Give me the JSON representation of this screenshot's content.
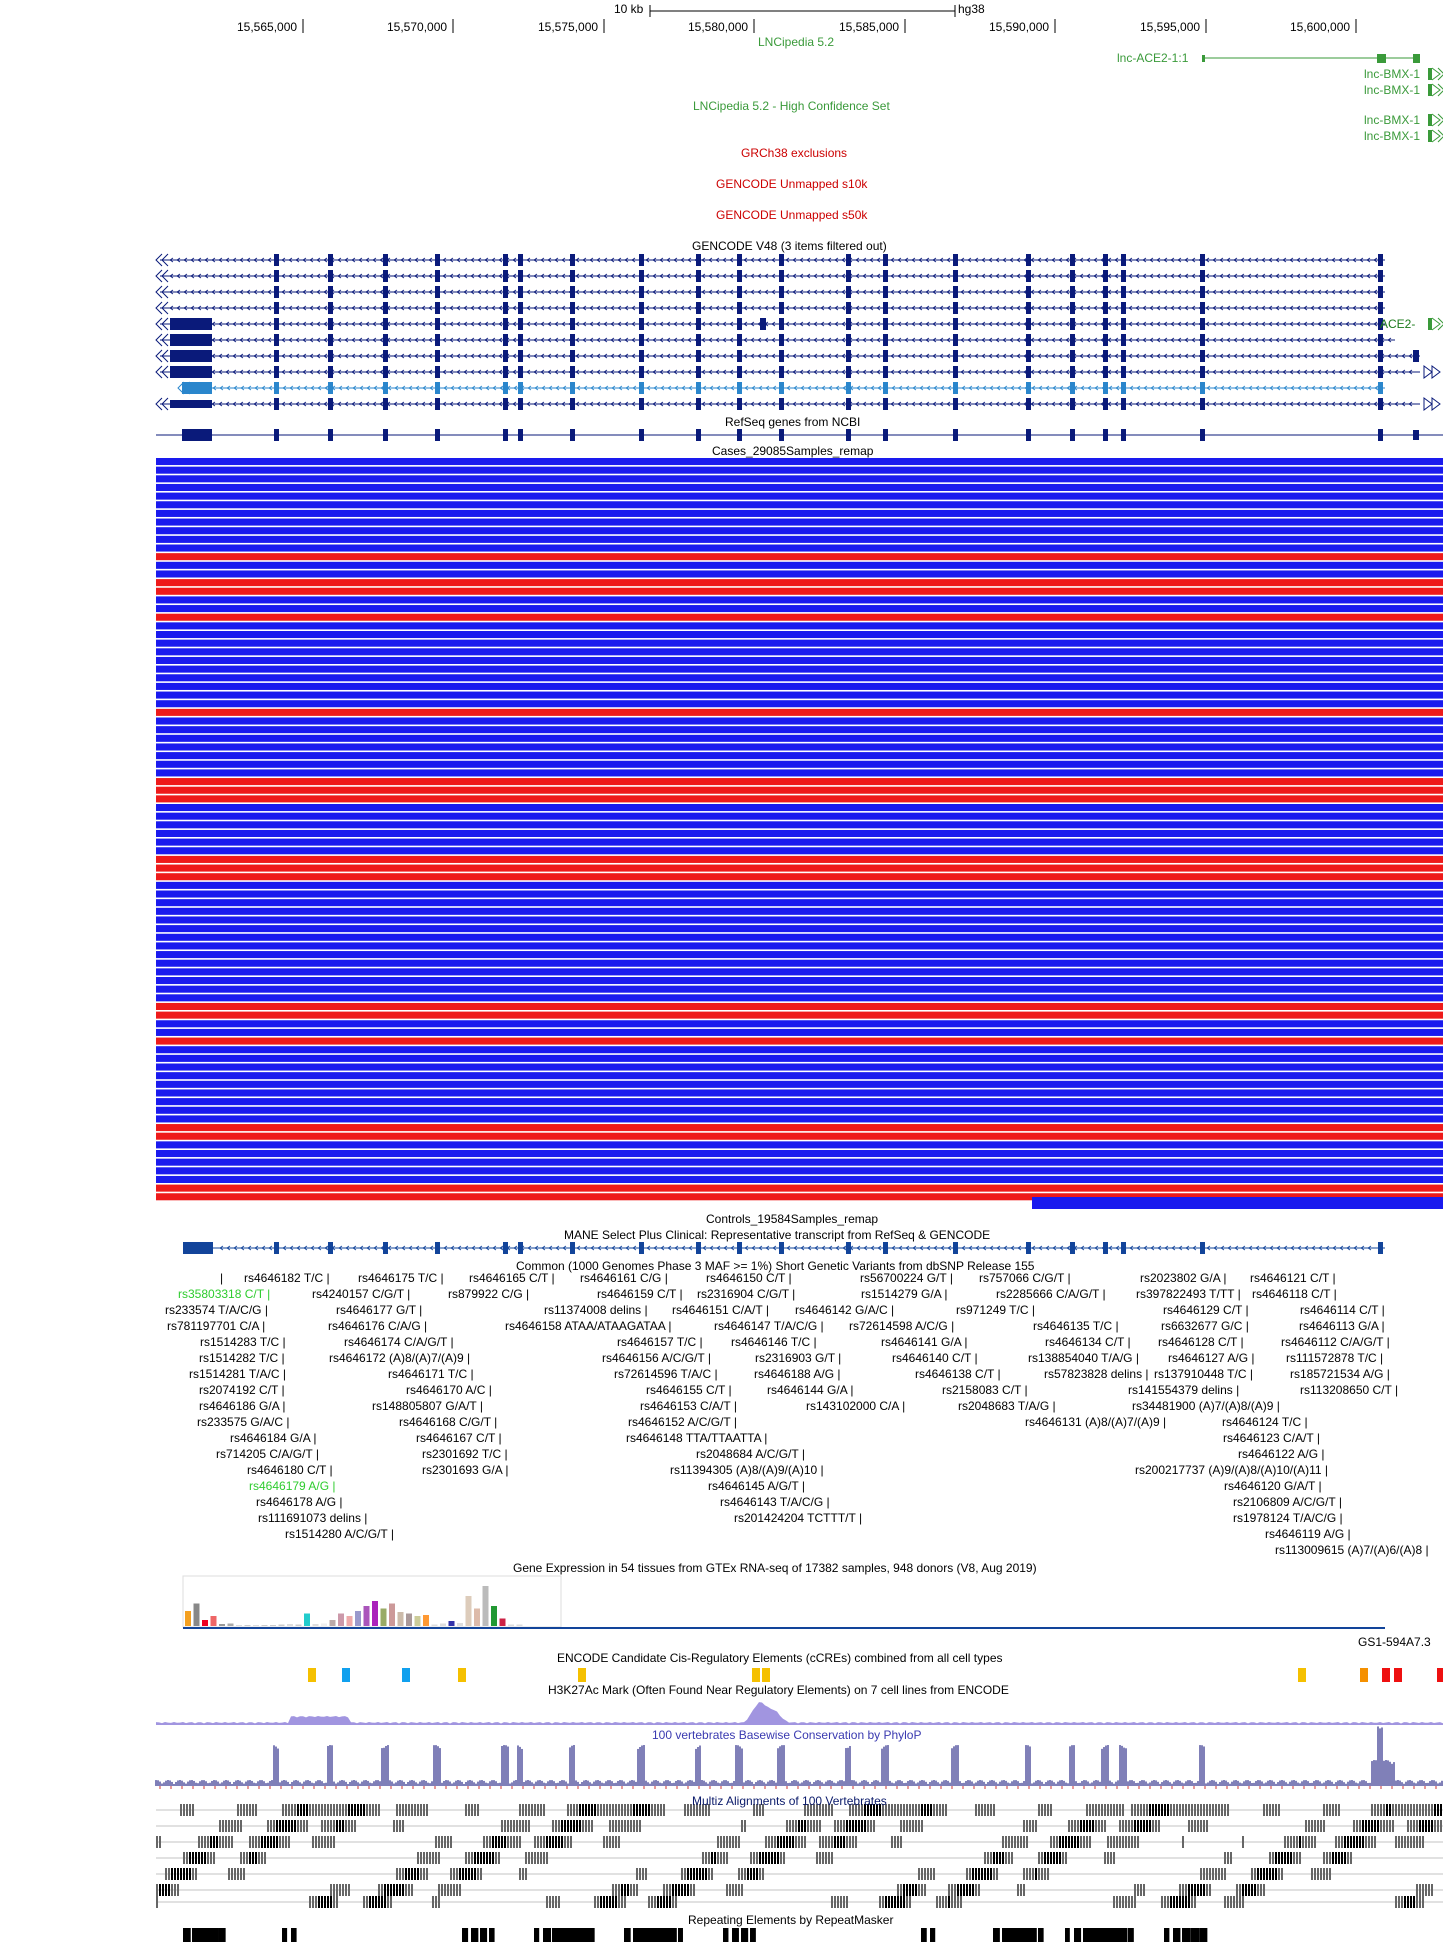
{
  "ruler": {
    "scale_label": "10 kb",
    "assembly": "hg38",
    "positions": [
      "15,565,000",
      "15,570,000",
      "15,575,000",
      "15,580,000",
      "15,585,000",
      "15,590,000",
      "15,595,000",
      "15,600,000"
    ]
  },
  "tracks": {
    "lncipedia": "LNCipedia 5.2",
    "lncipedia_hc": "LNCipedia 5.2 - High Confidence Set",
    "grch38_exclusions": "GRCh38 exclusions",
    "gencode_unmapped_10k": "GENCODE Unmapped s10k",
    "gencode_unmapped_50k": "GENCODE Unmapped s50k",
    "gencode_v48": "GENCODE V48 (3 items filtered out)",
    "refseq": "RefSeq genes from NCBI",
    "cases": "Cases_29085Samples_remap",
    "controls": "Controls_19584Samples_remap",
    "mane": "MANE Select Plus Clinical: Representative transcript from RefSeq & GENCODE",
    "dbsnp": "Common (1000 Genomes Phase 3 MAF >= 1%) Short Genetic Variants from dbSNP Release 155",
    "gtex": "Gene Expression in 54 tissues from GTEx RNA-seq of 17382 samples, 948 donors (V8, Aug 2019)",
    "gtex_gene": "GS1-594A7.3",
    "ccre": "ENCODE Candidate Cis-Regulatory Elements (cCREs) combined from all cell types",
    "h3k27ac": "H3K27Ac Mark (Often Found Near Regulatory Elements) on 7 cell lines from ENCODE",
    "phylop": "100 vertebrates Basewise Conservation by PhyloP",
    "multiz": "Multiz Alignments of 100 Vertebrates",
    "repeatmasker": "Repeating Elements by RepeatMasker"
  },
  "lnc_items": {
    "ace2": "lnc-ACE2-1:1",
    "bmx1": "lnc-BMX-1",
    "bmx2": "lnc-BMX-1",
    "bmx3": "lnc-BMX-1",
    "bmx4": "lnc-BMX-1",
    "ace2_gene": "ACE2-"
  },
  "snps": [
    {
      "t": "rs4646182 T/C",
      "c": "#000"
    },
    {
      "t": "rs4646175 T/C",
      "c": "#000"
    },
    {
      "t": "rs4646165 C/T",
      "c": "#000"
    },
    {
      "t": "rs4646161 C/G",
      "c": "#000"
    },
    {
      "t": "rs4646150 C/T",
      "c": "#000"
    },
    {
      "t": "rs56700224 G/T",
      "c": "#000"
    },
    {
      "t": "rs757066 C/G/T",
      "c": "#000"
    },
    {
      "t": "rs2023802 G/A",
      "c": "#000"
    },
    {
      "t": "rs4646121 C/T",
      "c": "#000"
    },
    {
      "t": "rs35803318 C/T",
      "c": "#2ecc2e"
    },
    {
      "t": "rs4240157 C/G/T",
      "c": "#000"
    },
    {
      "t": "rs879922 C/G",
      "c": "#000"
    },
    {
      "t": "rs4646159 C/T",
      "c": "#000"
    },
    {
      "t": "rs2316904 C/G/T",
      "c": "#000"
    },
    {
      "t": "rs1514279 G/A",
      "c": "#000"
    },
    {
      "t": "rs2285666 C/A/G/T",
      "c": "#000"
    },
    {
      "t": "rs397822493 T/TT",
      "c": "#000"
    },
    {
      "t": "rs4646118 C/T",
      "c": "#000"
    },
    {
      "t": "rs233574 T/A/C/G",
      "c": "#000"
    },
    {
      "t": "rs4646177 G/T",
      "c": "#000"
    },
    {
      "t": "rs11374008 delins",
      "c": "#000"
    },
    {
      "t": "rs4646151 C/A/T",
      "c": "#000"
    },
    {
      "t": "rs4646142 G/A/C",
      "c": "#000"
    },
    {
      "t": "rs971249 T/C",
      "c": "#000"
    },
    {
      "t": "rs4646129 C/T",
      "c": "#000"
    },
    {
      "t": "rs4646114 C/T",
      "c": "#000"
    },
    {
      "t": "rs781197701 C/A",
      "c": "#000"
    },
    {
      "t": "rs4646176 C/A/G",
      "c": "#000"
    },
    {
      "t": "rs4646158 ATAA/ATAAGATAA",
      "c": "#000"
    },
    {
      "t": "rs4646147 T/A/C/G",
      "c": "#000"
    },
    {
      "t": "rs72614598 A/C/G",
      "c": "#000"
    },
    {
      "t": "rs4646135 T/C",
      "c": "#000"
    },
    {
      "t": "rs6632677 G/C",
      "c": "#000"
    },
    {
      "t": "rs4646113 G/A",
      "c": "#000"
    },
    {
      "t": "rs1514283 T/C",
      "c": "#000"
    },
    {
      "t": "rs4646174 C/A/G/T",
      "c": "#000"
    },
    {
      "t": "rs4646157 T/C",
      "c": "#000"
    },
    {
      "t": "rs4646146 T/C",
      "c": "#000"
    },
    {
      "t": "rs4646141 G/A",
      "c": "#000"
    },
    {
      "t": "rs4646134 C/T",
      "c": "#000"
    },
    {
      "t": "rs4646128 C/T",
      "c": "#000"
    },
    {
      "t": "rs4646112 C/A/G/T",
      "c": "#000"
    },
    {
      "t": "rs1514282 T/C",
      "c": "#000"
    },
    {
      "t": "rs4646172 (A)8/(A)7/(A)9",
      "c": "#000"
    },
    {
      "t": "rs4646156 A/C/G/T",
      "c": "#000"
    },
    {
      "t": "rs2316903 G/T",
      "c": "#000"
    },
    {
      "t": "rs4646140 C/T",
      "c": "#000"
    },
    {
      "t": "rs138854040 T/A/G",
      "c": "#000"
    },
    {
      "t": "rs4646127 A/G",
      "c": "#000"
    },
    {
      "t": "rs111572878 T/C",
      "c": "#000"
    },
    {
      "t": "rs1514281 T/A/C",
      "c": "#000"
    },
    {
      "t": "rs4646171 T/C",
      "c": "#000"
    },
    {
      "t": "rs72614596 T/A/C",
      "c": "#000"
    },
    {
      "t": "rs4646188 A/G",
      "c": "#000"
    },
    {
      "t": "rs4646138 C/T",
      "c": "#000"
    },
    {
      "t": "rs57823828 delins",
      "c": "#000"
    },
    {
      "t": "rs137910448 T/C",
      "c": "#000"
    },
    {
      "t": "rs185721534 A/G",
      "c": "#000"
    },
    {
      "t": "rs2074192 C/T",
      "c": "#000"
    },
    {
      "t": "rs4646170 A/C",
      "c": "#000"
    },
    {
      "t": "rs4646155 C/T",
      "c": "#000"
    },
    {
      "t": "rs4646144 G/A",
      "c": "#000"
    },
    {
      "t": "rs2158083 C/T",
      "c": "#000"
    },
    {
      "t": "rs141554379 delins",
      "c": "#000"
    },
    {
      "t": "rs113208650 C/T",
      "c": "#000"
    },
    {
      "t": "rs4646186 G/A",
      "c": "#000"
    },
    {
      "t": "rs148805807 G/A/T",
      "c": "#000"
    },
    {
      "t": "rs4646153 C/A/T",
      "c": "#000"
    },
    {
      "t": "rs143102000 C/A",
      "c": "#000"
    },
    {
      "t": "rs2048683 T/A/G",
      "c": "#000"
    },
    {
      "t": "rs34481900 (A)7/(A)8/(A)9",
      "c": "#000"
    },
    {
      "t": "rs233575 G/A/C",
      "c": "#000"
    },
    {
      "t": "rs4646168 C/G/T",
      "c": "#000"
    },
    {
      "t": "rs4646152 A/C/G/T",
      "c": "#000"
    },
    {
      "t": "rs4646131 (A)8/(A)7/(A)9",
      "c": "#000"
    },
    {
      "t": "rs4646124 T/C",
      "c": "#000"
    },
    {
      "t": "rs4646184 G/A",
      "c": "#000"
    },
    {
      "t": "rs4646167 C/T",
      "c": "#000"
    },
    {
      "t": "rs4646148 TTA/TTAATTA",
      "c": "#000"
    },
    {
      "t": "rs4646123 C/A/T",
      "c": "#000"
    },
    {
      "t": "rs714205 C/A/G/T",
      "c": "#000"
    },
    {
      "t": "rs2301692 T/C",
      "c": "#000"
    },
    {
      "t": "rs2048684 A/C/G/T",
      "c": "#000"
    },
    {
      "t": "rs4646122 A/G",
      "c": "#000"
    },
    {
      "t": "rs4646180 C/T",
      "c": "#000"
    },
    {
      "t": "rs2301693 G/A",
      "c": "#000"
    },
    {
      "t": "rs11394305 (A)8/(A)9/(A)10",
      "c": "#000"
    },
    {
      "t": "rs200217737 (A)9/(A)8/(A)10/(A)11",
      "c": "#000"
    },
    {
      "t": "rs4646179 A/G",
      "c": "#2ecc2e"
    },
    {
      "t": "rs4646145 A/G/T",
      "c": "#000"
    },
    {
      "t": "rs4646120 G/A/T",
      "c": "#000"
    },
    {
      "t": "rs4646178 A/G",
      "c": "#000"
    },
    {
      "t": "rs4646143 T/A/C/G",
      "c": "#000"
    },
    {
      "t": "rs2106809 A/C/G/T",
      "c": "#000"
    },
    {
      "t": "rs111691073 delins",
      "c": "#000"
    },
    {
      "t": "rs201424204 TCTTT/T",
      "c": "#000"
    },
    {
      "t": "rs1978124 T/A/C/G",
      "c": "#000"
    },
    {
      "t": "rs1514280 A/C/G/T",
      "c": "#000"
    },
    {
      "t": "rs4646119 A/G",
      "c": "#000"
    },
    {
      "t": "rs113009615 (A)7/(A)6/(A)8",
      "c": "#000"
    }
  ],
  "colors": {
    "gene_blue": "#0a1a7a",
    "case_blue": "#1a1aee",
    "case_red": "#ee1a1a",
    "green_lnc": "#3a9a3a",
    "red_track": "#cc0000",
    "phylop": "#2a2a88"
  }
}
